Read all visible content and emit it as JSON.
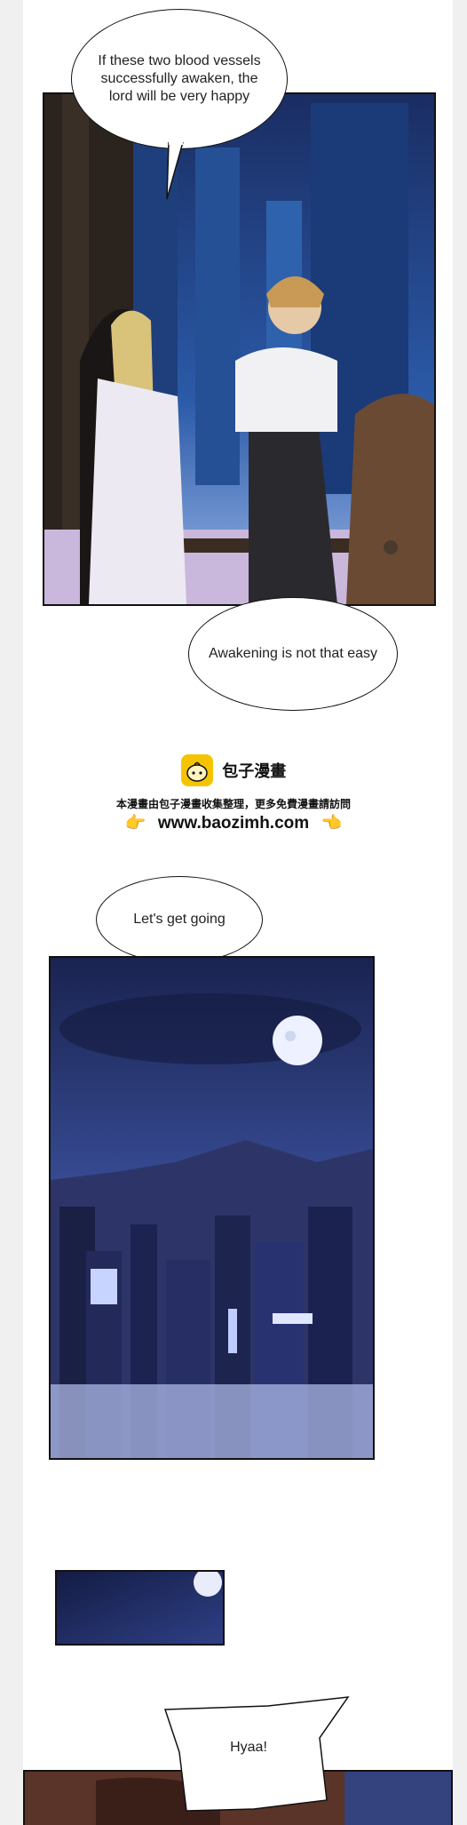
{
  "bubbles": {
    "b1": "If these two blood vessels successfully awaken, the lord will be very happy",
    "b2": "Awakening is not that easy",
    "b3": "Let's get going",
    "b4": "Hyaa!"
  },
  "watermark": {
    "brand": "包子漫畫",
    "notice": "本漫畫由包子漫畫收集整理，更多免費漫畫請訪問",
    "url": "www.baozimh.com",
    "left_hand": "👉",
    "right_hand": "👈"
  },
  "colors": {
    "logo": "#f5c400",
    "night_sky": "#1c2a5e",
    "city_glow": "#8fb0ff"
  }
}
